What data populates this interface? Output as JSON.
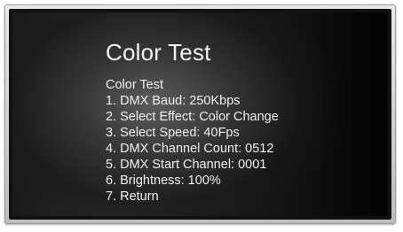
{
  "screen": {
    "title": "Color Test",
    "subtitle": "Color Test",
    "items": [
      "1. DMX Baud: 250Kbps",
      "2. Select Effect: Color Change",
      "3. Select Speed: 40Fps",
      "4. DMX Channel Count: 0512",
      "5. DMX Start Channel: 0001",
      "6. Brightness: 100%",
      "7. Return"
    ]
  }
}
